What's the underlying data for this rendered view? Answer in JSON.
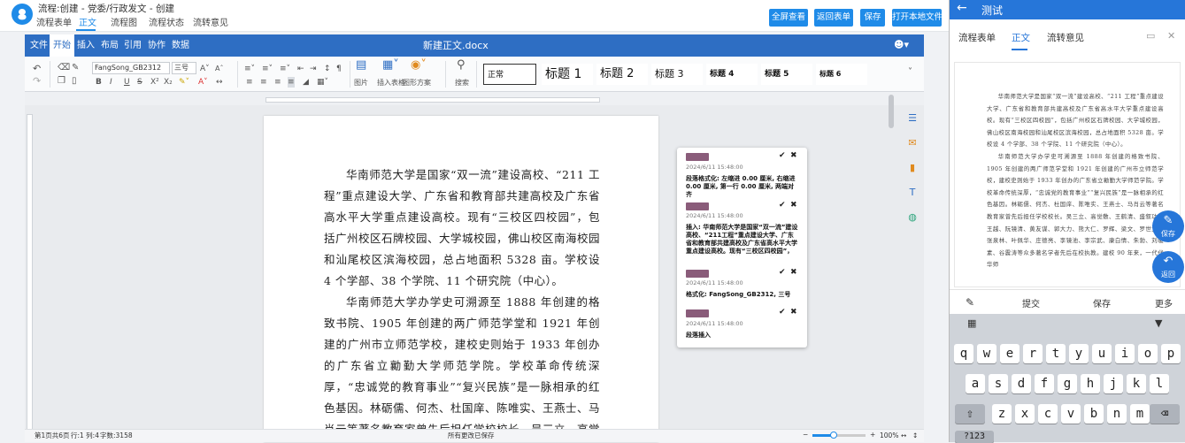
{
  "topbar": {
    "title": "流程:创建 - 党委/行政发文 - 创建",
    "tabs": [
      "流程表单",
      "正文",
      "流程图",
      "流程状态",
      "流转意见"
    ],
    "active_tab": "正文",
    "buttons": [
      "全屏查看",
      "返回表单",
      "保存",
      "打开本地文件"
    ]
  },
  "editor": {
    "menus": [
      "文件",
      "开始",
      "插入",
      "布局",
      "引用",
      "协作",
      "数据"
    ],
    "active_menu": "开始",
    "doc_name": "新建正文.docx",
    "ribbon": {
      "font": "FangSong_GB2312",
      "size": "三号",
      "picture": "图片",
      "insert_table": "插入表格",
      "layout_options": "图形方案",
      "search": "搜索",
      "styles": [
        "正常",
        "标题 1",
        "标题 2",
        "标题 3",
        "标题 4",
        "标题 5",
        "标题 6"
      ]
    },
    "paragraphs": [
      "华南师范大学是国家“双一流”建设高校、“211 工程”重点建设大学、广东省和教育部共建高校及广东省高水平大学重点建设高校。现有“三校区四校园”，包括广州校区石牌校园、大学城校园，佛山校区南海校园和汕尾校区滨海校园，总占地面积 5328 亩。学校设 4 个学部、38 个学院、11 个研究院（中心）。",
      "华南师范大学办学史可溯源至 1888 年创建的格致书院、1905 年创建的两广师范学堂和 1921 年创建的广州市立师范学校，建校史则始于 1933 年创办的广东省立勷勤大学师范学院。学校革命传统深厚，“忠诚党的教育事业”“复兴民族”是一脉相承的红色基因。林砺儒、何杰、杜国庠、陈唯实、王燕士、马肖云等著名教育家曾先后担任学校校长。吴三立、高觉敷、王鹤清、盛叙功、王越、阮镜清、黄友谋、"
    ],
    "comments": [
      {
        "time": "2024/6/11 15:48:00",
        "text": "段落格式化: 左缩进 0.00 厘米, 右缩进 0.00 厘米, 第一行 0.00 厘米, 两端对齐"
      },
      {
        "time": "2024/6/11 15:48:00",
        "text": "插入:    华南师范大学是国家“双一流”建设高校、“211工程”重点建设大学、广东省和教育部共建高校及广东省高水平大学重点建设高校。现有“三校区四校园”，包括广州校区石牌校园、大学城校园，"
      },
      {
        "time": "2024/6/11 15:48:00",
        "text": "格式化: FangSong_GB2312, 三号"
      },
      {
        "time": "2024/6/11 15:48:00",
        "text": "段落插入"
      }
    ],
    "status": {
      "pages": "第1页共6页",
      "position": "行:1 列:4",
      "word_count": "字数:3158",
      "save_state": "所有更改已保存",
      "zoom": "100%",
      "zoom_fraction": 0.4
    }
  },
  "mobile": {
    "title": "测试",
    "tabs": [
      "流程表单",
      "正文",
      "流转意见"
    ],
    "active_tab": "正文",
    "doc_paragraphs": [
      "华南师范大学是国家“双一流”建设高校、“211 工程”重点建设大学、广东省和教育部共建高校及广东省高水平大学重点建设高校。现有“三校区四校园”，包括广州校区石牌校园、大学城校园，佛山校区南海校园和汕尾校区滨海校园，总占地面积 5328 亩。学校设 4 个学部、38 个学院、11 个研究院（中心）。",
      "华南师范大学办学史可溯源至 1888 年创建的格致书院、1905 年创建的两广师范学堂和 1921 年创建的广州市立师范学校，建校史则始于 1933 年创办的广东省立勷勤大学师范学院。学校革命传统深厚，“忠诚党的教育事业”“复兴民族”是一脉相承的红色基因。林砺儒、何杰、杜国庠、陈唯实、王燕士、马肖云等著名教育家曾先后担任学校校长。吴三立、高觉敷、王鹤清、盛叙功、王越、阮镜清、黄友谋、郭大力、熊大仁、罗辉、梁文、罗世文、张泉林、叶佩华、庄德亮、李镜池、李宗武、康白情、朱勃、刘暖素、谷震涛等众多著名学者先后在校执教。建校 90 年来，一代代华师"
    ],
    "fab_save": "保存",
    "fab_back": "返回",
    "toolbar": [
      "提交",
      "保存",
      "更多"
    ],
    "keyboard_rows": [
      [
        "q",
        "w",
        "e",
        "r",
        "t",
        "y",
        "u",
        "i",
        "o",
        "p"
      ],
      [
        "a",
        "s",
        "d",
        "f",
        "g",
        "h",
        "j",
        "k",
        "l"
      ],
      [
        "z",
        "x",
        "c",
        "v",
        "b",
        "n",
        "m"
      ]
    ],
    "keyboard_bottom": "?123"
  }
}
